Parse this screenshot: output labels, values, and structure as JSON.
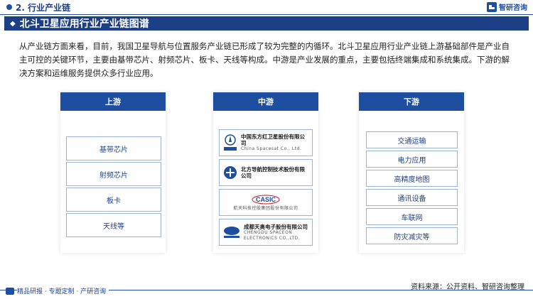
{
  "header": {
    "section_title": "2. 行业产业链",
    "brand": "智研咨询"
  },
  "banner": {
    "title": "北斗卫星应用行业产业链图谱"
  },
  "intro": "从产业链方面来看，目前，我国卫星导航与位置服务产业链已形成了较为完整的内循环。北斗卫星应用行业产业链上游基础部件是产业自主可控的关键环节，主要由基带芯片、射频芯片、板卡、天线等构成。中游是产业发展的重点，主要包括终端集成和系统集成。下游的解决方案和运维服务提供众多行业应用。",
  "upstream": {
    "title": "上游",
    "items": [
      "基带芯片",
      "射频芯片",
      "板卡",
      "天线等"
    ]
  },
  "midstream": {
    "title": "中游",
    "companies": [
      {
        "name": "中国东方红卫星股份有限公司",
        "sub": "China Spacesat Co., Ltd.",
        "logo": "中国航天"
      },
      {
        "name": "北方导航控制技术股份有限公司",
        "sub": "",
        "logo": "中国兵器 北方导航"
      },
      {
        "name": "航天科技控股集团股份有限公司",
        "sub": "",
        "logo": "CASIC"
      },
      {
        "name": "成都天奥电子股份有限公司",
        "sub": "CHENGDU SPACEON ELECTRONICS CO.,LTD.",
        "logo": "ELECSPN"
      }
    ]
  },
  "downstream": {
    "title": "下游",
    "items": [
      "交通运输",
      "电力应用",
      "高精度地图",
      "通讯设备",
      "车联网",
      "防灾减灾等"
    ]
  },
  "footer": {
    "left": "精品研报 · 专题定制 · 产研咨询",
    "source": "资料来源：公开资料、智研咨询整理"
  },
  "colors": {
    "primary": "#1d4ea0",
    "dark": "#1d3f86"
  }
}
